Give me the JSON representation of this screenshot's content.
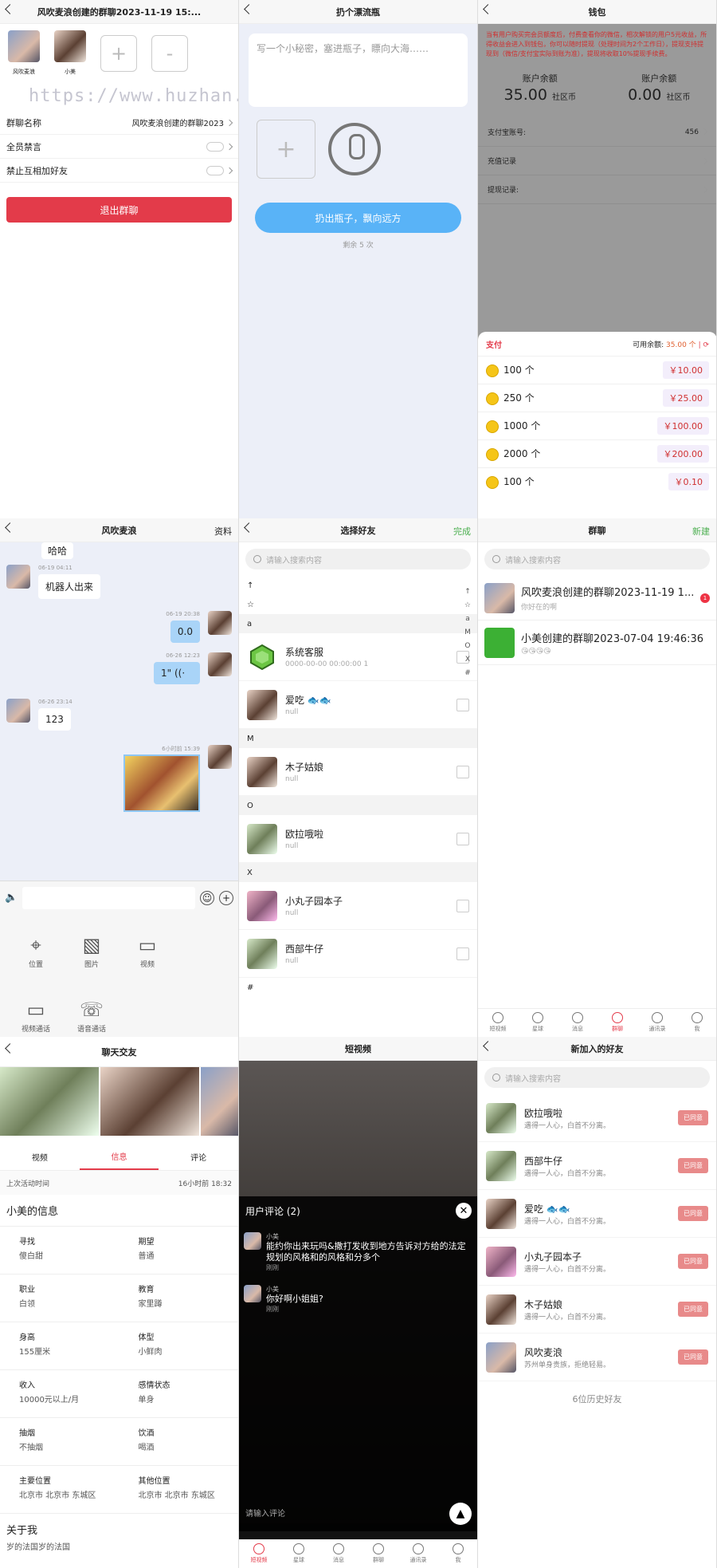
{
  "p1": {
    "title": "风吹麦浪创建的群聊2023-11-19 15:...",
    "members": [
      {
        "name": "风吹麦浪"
      },
      {
        "name": "小美"
      }
    ],
    "plus": "+",
    "minus": "-",
    "watermark": "https://www.huzhan.com/ishop41618",
    "rows": [
      {
        "label": "群聊名称",
        "value": "风吹麦浪创建的群聊2023"
      },
      {
        "label": "全员禁言"
      },
      {
        "label": "禁止互相加好友"
      }
    ],
    "exit": "退出群聊"
  },
  "p2": {
    "title": "扔个漂流瓶",
    "placeholder": "写一个小秘密，塞进瓶子，瞟向大海……",
    "plus": "+",
    "button": "扔出瓶子，飘向远方",
    "remain": "剩余 5 次"
  },
  "p3": {
    "title": "钱包",
    "notice": "当有用户购买完会员额度后，付费查看你的微信，相次解锁的用户5元收益，所得收益会进入到钱包，你可以随时提现（处理时间为2个工作日），提现支持提现到（微信/支付宝实际到账为准），提现将收取10%提现手续费。",
    "balances": [
      {
        "label": "账户余额",
        "value": "35.00",
        "unit": "社区币"
      },
      {
        "label": "账户余额",
        "value": "0.00",
        "unit": "社区币"
      }
    ],
    "rows": [
      {
        "label": "支付宝账号:",
        "value": "456"
      },
      {
        "label": "充值记录"
      },
      {
        "label": "提现记录:"
      }
    ],
    "pay": {
      "title": "支付",
      "available_label": "可用余额:",
      "available": "35.00 个",
      "items": [
        {
          "amount": "100 个",
          "price": "￥10.00"
        },
        {
          "amount": "250 个",
          "price": "￥25.00"
        },
        {
          "amount": "1000 个",
          "price": "￥100.00"
        },
        {
          "amount": "2000 个",
          "price": "￥200.00"
        },
        {
          "amount": "100 个",
          "price": "￥0.10"
        }
      ]
    }
  },
  "p4": {
    "title": "风吹麦浪",
    "right": "资料",
    "partial": "哈哈",
    "messages": [
      {
        "time": "06-19 04:11",
        "text": "机器人出来"
      },
      {
        "time": "06-19 20:38",
        "text": "0.0"
      },
      {
        "time": "06-26 12:23",
        "text": "1\" ((·"
      },
      {
        "time": "06-26 23:14",
        "text": "123"
      },
      {
        "time": "6小时前 15:39"
      }
    ],
    "tools": [
      {
        "label": "位置",
        "icon": "location-icon"
      },
      {
        "label": "图片",
        "icon": "image-icon"
      },
      {
        "label": "视频",
        "icon": "video-icon"
      },
      {
        "label": "视频通话",
        "icon": "video-call-icon"
      },
      {
        "label": "语音通话",
        "icon": "phone-icon"
      }
    ]
  },
  "p5": {
    "title": "选择好友",
    "done": "完成",
    "search": "请输入搜索内容",
    "index": [
      "↑",
      "☆",
      "a",
      "M",
      "O",
      "X",
      "#"
    ],
    "sections": [
      {
        "header": "↑",
        "friends": []
      },
      {
        "header": "☆",
        "friends": []
      },
      {
        "header": "a",
        "friends": [
          {
            "name": "系统客服",
            "sub": "0000-00-00 00:00:00 1"
          },
          {
            "name": "爱吃 🐟🐟",
            "sub": "null"
          }
        ]
      },
      {
        "header": "M",
        "friends": [
          {
            "name": "木子姑娘",
            "sub": "null"
          }
        ]
      },
      {
        "header": "O",
        "friends": [
          {
            "name": "欧拉哦啦",
            "sub": "null"
          }
        ]
      },
      {
        "header": "X",
        "friends": [
          {
            "name": "小丸子园本子",
            "sub": "null"
          },
          {
            "name": "西部牛仔",
            "sub": "null"
          }
        ]
      },
      {
        "header": "#",
        "friends": []
      }
    ]
  },
  "p6": {
    "title": "群聊",
    "right": "新建",
    "search": "请输入搜索内容",
    "groups": [
      {
        "name": "风吹麦浪创建的群聊2023-11-19 1...",
        "sub": "你好在的啊",
        "badge": "1"
      },
      {
        "name": "小美创建的群聊2023-07-04 19:46:36",
        "sub": "😘😘😘😘"
      }
    ],
    "tabs": [
      "短视频",
      "星球",
      "消息",
      "群聊",
      "通讯录",
      "我"
    ]
  },
  "p7": {
    "title": "聊天交友",
    "tabs": [
      "视频",
      "信息",
      "评论"
    ],
    "last_label": "上次活动时间",
    "last_value": "16小时前 18:32",
    "info_title": "小美的信息",
    "info": [
      {
        "k": "寻找",
        "v": "傻白甜"
      },
      {
        "k": "期望",
        "v": "普通"
      },
      {
        "k": "职业",
        "v": "白领"
      },
      {
        "k": "教育",
        "v": "家里蹲"
      },
      {
        "k": "身高",
        "v": "155厘米"
      },
      {
        "k": "体型",
        "v": "小鲜肉"
      },
      {
        "k": "收入",
        "v": "10000元以上/月"
      },
      {
        "k": "感情状态",
        "v": "单身"
      },
      {
        "k": "抽烟",
        "v": "不抽烟"
      },
      {
        "k": "饮酒",
        "v": "喝酒"
      },
      {
        "k": "主要位置",
        "v": "北京市 北京市 东城区"
      },
      {
        "k": "其他位置",
        "v": "北京市 北京市 东城区"
      }
    ],
    "about_title": "关于我",
    "about": "岁的法国岁的法国"
  },
  "p8": {
    "title": "短视频",
    "comments_title": "用户评论 (2)",
    "comments": [
      {
        "name": "小美",
        "text": "能约你出来玩吗&撒打发收到地方告诉对方给的法定规划的风格和的风格和分多个",
        "meta": "刚刚"
      },
      {
        "name": "小美",
        "text": "你好啊小姐姐?",
        "meta": "刚刚"
      }
    ],
    "input": "请输入评论",
    "tabs": [
      "短视频",
      "星球",
      "消息",
      "群聊",
      "通讯录",
      "我"
    ]
  },
  "p9": {
    "title": "新加入的好友",
    "search": "请输入搜索内容",
    "friends": [
      {
        "name": "欧拉哦啦",
        "sub": "遇得一人心，白首不分离。"
      },
      {
        "name": "西部牛仔",
        "sub": "遇得一人心，白首不分离。"
      },
      {
        "name": "爱吃 🐟🐟",
        "sub": "遇得一人心，白首不分离。"
      },
      {
        "name": "小丸子园本子",
        "sub": "遇得一人心，白首不分离。"
      },
      {
        "name": "木子姑娘",
        "sub": "遇得一人心，白首不分离。"
      },
      {
        "name": "风吹麦浪",
        "sub": "苏州单身贵族，拒绝轻易。"
      }
    ],
    "agreed": "已同意",
    "history": "6位历史好友"
  }
}
